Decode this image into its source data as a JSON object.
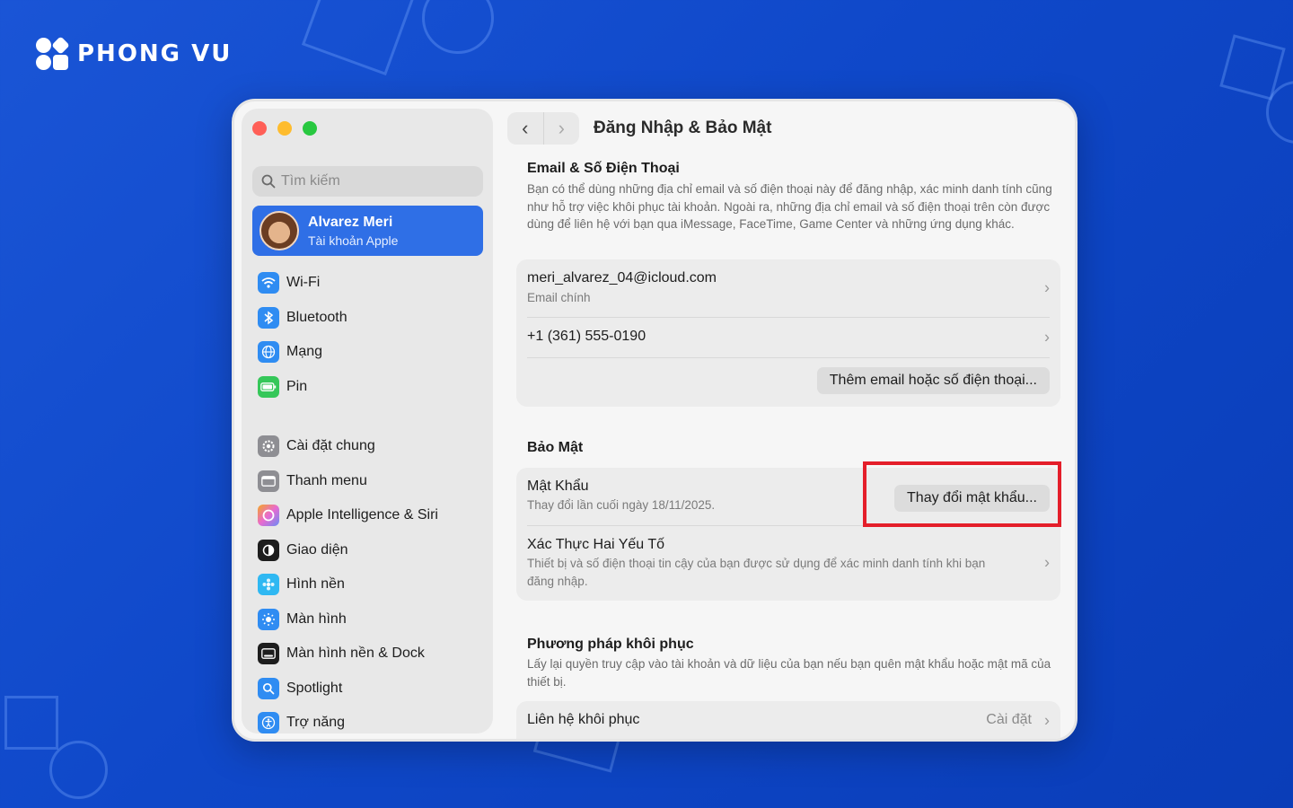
{
  "brand": {
    "name": "PHONG VU"
  },
  "window": {
    "title": "Đăng Nhập & Bảo Mật"
  },
  "sidebar": {
    "search_placeholder": "Tìm kiếm",
    "account": {
      "name": "Alvarez Meri",
      "subtitle": "Tài khoản Apple"
    },
    "items": [
      {
        "label": "Wi-Fi",
        "icon": "wifi-icon",
        "color": "#2f8cf2"
      },
      {
        "label": "Bluetooth",
        "icon": "bluetooth-icon",
        "color": "#2f8cf2"
      },
      {
        "label": "Mạng",
        "icon": "globe-icon",
        "color": "#2f8cf2"
      },
      {
        "label": "Pin",
        "icon": "battery-icon",
        "color": "#35c759"
      },
      {
        "label": "Cài đặt chung",
        "icon": "gear-icon",
        "color": "#8e8e93"
      },
      {
        "label": "Thanh menu",
        "icon": "menubar-icon",
        "color": "#8e8e93"
      },
      {
        "label": "Apple Intelligence & Siri",
        "icon": "siri-icon",
        "color": "#e86ad0"
      },
      {
        "label": "Giao diện",
        "icon": "appearance-icon",
        "color": "#1d1d1d"
      },
      {
        "label": "Hình nền",
        "icon": "wallpaper-icon",
        "color": "#2fb8f2"
      },
      {
        "label": "Màn hình",
        "icon": "display-icon",
        "color": "#2f8cf2"
      },
      {
        "label": "Màn hình nền & Dock",
        "icon": "dock-icon",
        "color": "#1d1d1d"
      },
      {
        "label": "Spotlight",
        "icon": "spotlight-icon",
        "color": "#2f8cf2"
      },
      {
        "label": "Trợ năng",
        "icon": "accessibility-icon",
        "color": "#2f8cf2"
      }
    ]
  },
  "email_section": {
    "title": "Email & Số Điện Thoại",
    "description": "Bạn có thể dùng những địa chỉ email và số điện thoại này để đăng nhập, xác minh danh tính cũng như hỗ trợ việc khôi phục tài khoản. Ngoài ra, những địa chỉ email và số điện thoại trên còn được dùng để liên hệ với bạn qua iMessage, FaceTime, Game Center và những ứng dụng khác.",
    "email": "meri_alvarez_04@icloud.com",
    "email_label": "Email chính",
    "phone": "+1 (361) 555-0190",
    "add_button": "Thêm email hoặc số điện thoại..."
  },
  "security_section": {
    "title": "Bảo Mật",
    "password_title": "Mật Khẩu",
    "password_sub": "Thay đổi lần cuối ngày 18/11/2025.",
    "change_password_button": "Thay đổi mật khẩu...",
    "twofa_title": "Xác Thực Hai Yếu Tố",
    "twofa_sub": "Thiết bị và số điện thoại tin cậy của bạn được sử dụng để xác minh danh tính khi bạn đăng nhập."
  },
  "recovery_section": {
    "title": "Phương pháp khôi phục",
    "description": "Lấy lại quyền truy cập vào tài khoản và dữ liệu của bạn nếu bạn quên mật khẩu hoặc mật mã của thiết bị.",
    "contact_label": "Liên hệ khôi phục",
    "contact_value": "Cài đặt"
  },
  "colors": {
    "accent": "#2f6fe6",
    "highlight": "#e41e2a",
    "background": "#1150d0"
  }
}
